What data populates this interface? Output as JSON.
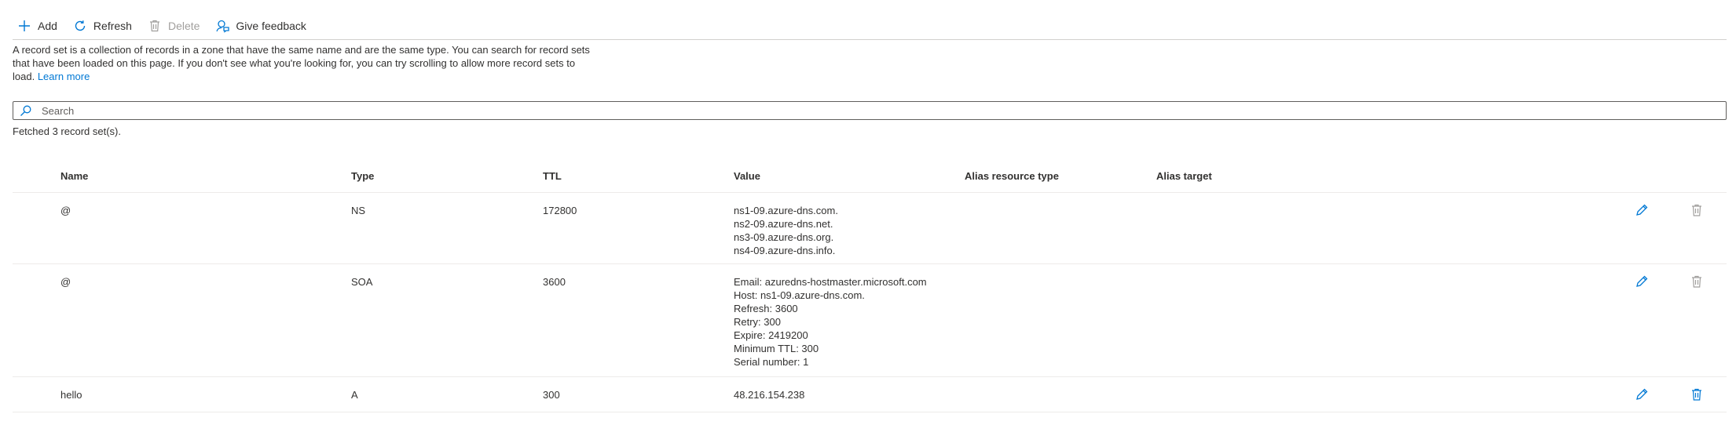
{
  "toolbar": {
    "add_label": "Add",
    "refresh_label": "Refresh",
    "delete_label": "Delete",
    "feedback_label": "Give feedback"
  },
  "description": {
    "text": "A record set is a collection of records in a zone that have the same name and are the same type. You can search for record sets that have been loaded on this page. If you don't see what you're looking for, you can try scrolling to allow more record sets to load.",
    "link": "Learn more"
  },
  "search": {
    "placeholder": "Search"
  },
  "fetched_text": "Fetched 3 record set(s).",
  "table": {
    "headers": {
      "name": "Name",
      "type": "Type",
      "ttl": "TTL",
      "value": "Value",
      "alias_type": "Alias resource type",
      "alias_target": "Alias target"
    },
    "rows": [
      {
        "name": "@",
        "type": "NS",
        "ttl": "172800",
        "values": [
          "ns1-09.azure-dns.com.",
          "ns2-09.azure-dns.net.",
          "ns3-09.azure-dns.org.",
          "ns4-09.azure-dns.info."
        ],
        "alias_type": "",
        "alias_target": "",
        "delete_enabled": false
      },
      {
        "name": "@",
        "type": "SOA",
        "ttl": "3600",
        "values": [
          "Email: azuredns-hostmaster.microsoft.com",
          "Host: ns1-09.azure-dns.com.",
          "Refresh: 3600",
          "Retry: 300",
          "Expire: 2419200",
          "Minimum TTL: 300",
          "Serial number: 1"
        ],
        "alias_type": "",
        "alias_target": "",
        "delete_enabled": false
      },
      {
        "name": "hello",
        "type": "A",
        "ttl": "300",
        "values": [
          "48.216.154.238"
        ],
        "alias_type": "",
        "alias_target": "",
        "delete_enabled": true
      }
    ]
  },
  "colors": {
    "accent": "#0078d4",
    "disabled": "#a19f9d",
    "text": "#323130"
  },
  "icons": {
    "add": "add-icon",
    "refresh": "refresh-icon",
    "delete": "delete-icon",
    "feedback": "feedback-icon",
    "search": "search-icon",
    "edit": "edit-icon"
  }
}
